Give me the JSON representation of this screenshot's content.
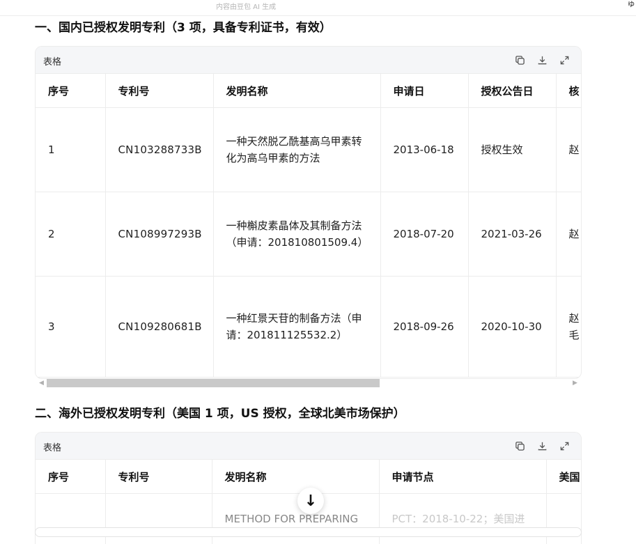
{
  "top_bar": {
    "ai_note": "内容由豆包 AI 生成",
    "corner_glyph": "ゅ"
  },
  "sections": [
    {
      "title": "一、国内已授权发明专利（3 项，具备专利证书，有效）",
      "card_label": "表格",
      "headers": [
        "序号",
        "专利号",
        "发明名称",
        "申请日",
        "授权公告日",
        "核"
      ],
      "rows": [
        [
          "1",
          "CN103288733B",
          "一种天然脱乙酰基高乌甲素转化为高乌甲素的方法",
          "2013-06-18",
          "授权生效",
          "赵"
        ],
        [
          "2",
          "CN108997293B",
          "一种槲皮素晶体及其制备方法（申请：201810801509.4）",
          "2018-07-20",
          "2021-03-26",
          "赵"
        ],
        [
          "3",
          "CN109280681B",
          "一种红景天苷的制备方法（申请：201811125532.2）",
          "2018-09-26",
          "2020-10-30",
          "赵\n毛"
        ]
      ]
    },
    {
      "title": "二、海外已授权发明专利（美国 1 项，US 授权，全球北美市场保护）",
      "card_label": "表格",
      "headers": [
        "序号",
        "专利号",
        "发明名称",
        "申请节点",
        "美国"
      ],
      "rows": [
        [
          "",
          "",
          "METHOD FOR PREPARING",
          "PCT：2018-10-22；美国进",
          ""
        ]
      ]
    }
  ],
  "icons": [
    "copy-icon",
    "download-icon",
    "expand-icon",
    "arrow-down-icon"
  ],
  "scroll_button_glyph": "↓"
}
